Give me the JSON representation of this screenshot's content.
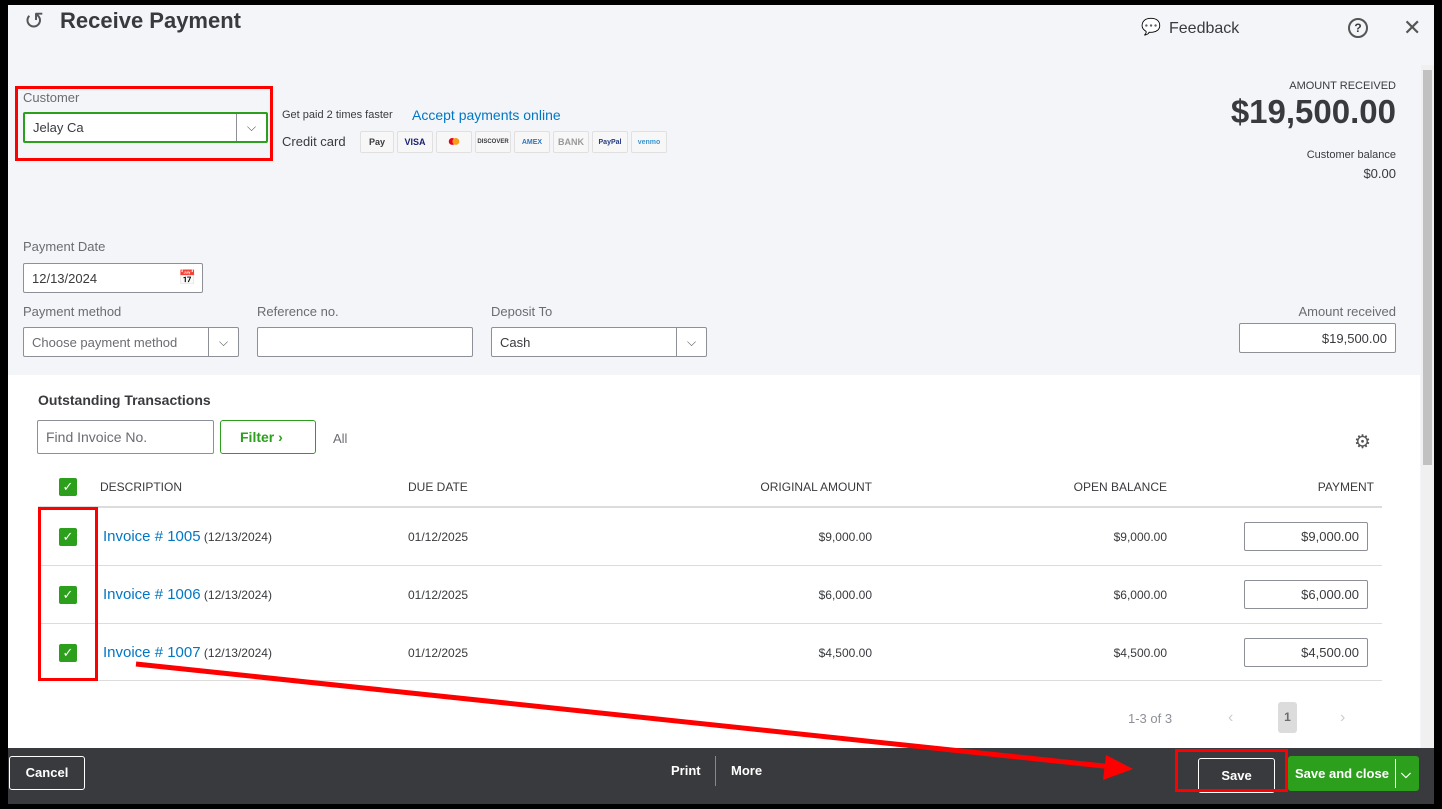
{
  "header": {
    "title": "Receive Payment",
    "feedback": "Feedback"
  },
  "customer": {
    "label": "Customer",
    "value": "Jelay Ca"
  },
  "promo": {
    "text": "Get paid 2 times faster",
    "link": "Accept payments online",
    "credit_card": "Credit card",
    "cards": [
      "Pay",
      "VISA",
      "",
      "DISCOVER",
      "AMEX",
      "BANK",
      "PayPal",
      "venmo"
    ]
  },
  "summary": {
    "amount_label": "AMOUNT RECEIVED",
    "amount": "$19,500.00",
    "balance_label": "Customer balance",
    "balance": "$0.00"
  },
  "form": {
    "date_label": "Payment Date",
    "date": "12/13/2024",
    "method_label": "Payment method",
    "method_placeholder": "Choose payment method",
    "ref_label": "Reference no.",
    "ref_value": "",
    "deposit_label": "Deposit To",
    "deposit": "Cash",
    "amount_label": "Amount received",
    "amount": "$19,500.00"
  },
  "outstanding": {
    "title": "Outstanding Transactions",
    "search_placeholder": "Find Invoice No.",
    "filter": "Filter",
    "all": "All",
    "columns": [
      "DESCRIPTION",
      "DUE DATE",
      "ORIGINAL AMOUNT",
      "OPEN BALANCE",
      "PAYMENT"
    ],
    "rows": [
      {
        "invoice": "Invoice # 1005",
        "date": "(12/13/2024)",
        "due": "01/12/2025",
        "original": "$9,000.00",
        "open": "$9,000.00",
        "payment": "$9,000.00"
      },
      {
        "invoice": "Invoice # 1006",
        "date": "(12/13/2024)",
        "due": "01/12/2025",
        "original": "$6,000.00",
        "open": "$6,000.00",
        "payment": "$6,000.00"
      },
      {
        "invoice": "Invoice # 1007",
        "date": "(12/13/2024)",
        "due": "01/12/2025",
        "original": "$4,500.00",
        "open": "$4,500.00",
        "payment": "$4,500.00"
      }
    ],
    "pagination": {
      "range": "1-3 of 3",
      "page": "1"
    }
  },
  "footer": {
    "cancel": "Cancel",
    "print": "Print",
    "more": "More",
    "save": "Save",
    "save_close": "Save and close"
  }
}
